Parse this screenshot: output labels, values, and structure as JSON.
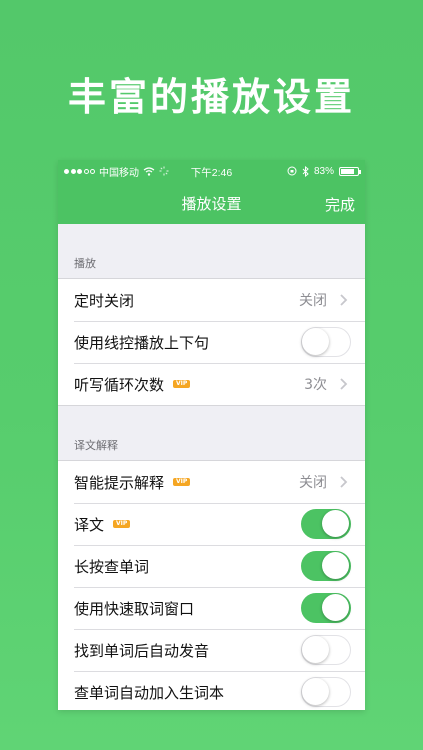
{
  "headline": "丰富的播放设置",
  "status_bar": {
    "carrier": "中国移动",
    "time": "下午2:46",
    "battery": "83%",
    "battery_level": 0.83
  },
  "nav": {
    "title": "播放设置",
    "done_label": "完成"
  },
  "sections": [
    {
      "header": "播放",
      "rows": [
        {
          "label": "定时关闭",
          "value": "关闭"
        },
        {
          "label": "使用线控播放上下句",
          "toggle": false
        },
        {
          "label": "听写循环次数",
          "vip": "VIP",
          "value": "3次"
        }
      ]
    },
    {
      "header": "译文解释",
      "rows": [
        {
          "label": "智能提示解释",
          "vip": "VIP",
          "value": "关闭"
        },
        {
          "label": "译文",
          "vip": "VIP",
          "toggle": true
        },
        {
          "label": "长按查单词",
          "toggle": true
        },
        {
          "label": "使用快速取词窗口",
          "toggle": true
        },
        {
          "label": "找到单词后自动发音",
          "toggle": false
        },
        {
          "label": "查单词自动加入生词本",
          "toggle": false
        }
      ]
    }
  ],
  "colors": {
    "accent": "#4cc363",
    "background": "#55cb6b",
    "vip_badge": "#f5a623"
  }
}
